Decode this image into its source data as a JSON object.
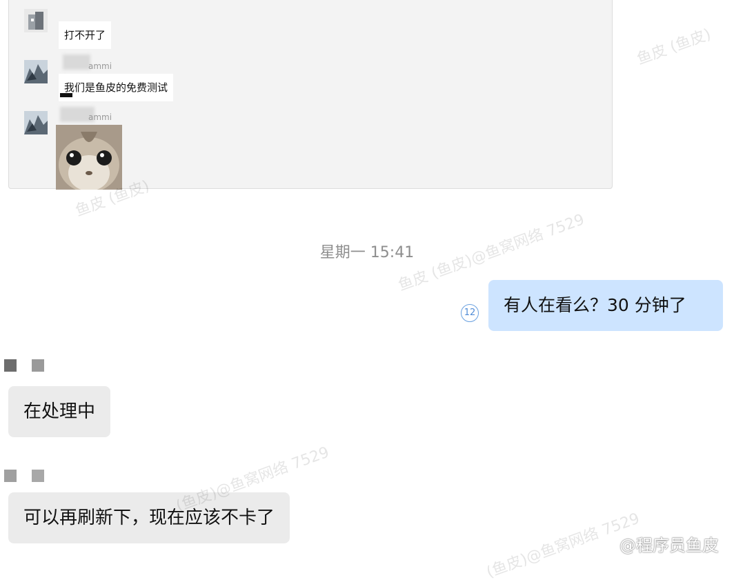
{
  "quoted": {
    "messages": [
      {
        "text": "打不开了"
      },
      {
        "sender": "ammi",
        "text": "我们是鱼皮的免费测试"
      },
      {
        "sender": "ammi",
        "image": "hamster-face-photo"
      }
    ]
  },
  "timestamp": "星期一 15:41",
  "outgoing": {
    "text": "有人在看么？30 分钟了",
    "read_count": "12"
  },
  "incoming": [
    {
      "text": "在处理中"
    },
    {
      "text": "可以再刷新下，现在应该不卡了"
    }
  ],
  "watermarks": [
    "鱼皮 (鱼皮)",
    "鱼皮 (鱼皮)",
    "鱼皮 (鱼皮)@鱼窝网络 7529",
    "(鱼皮)@鱼窝网络 7529",
    "(鱼皮)@鱼窝网络 7529"
  ],
  "source_mark": "@程序员鱼皮",
  "colors": {
    "outgoing_bubble": "#cde4ff",
    "incoming_bubble": "#ebebeb",
    "read_badge": "#4f8bd6"
  }
}
